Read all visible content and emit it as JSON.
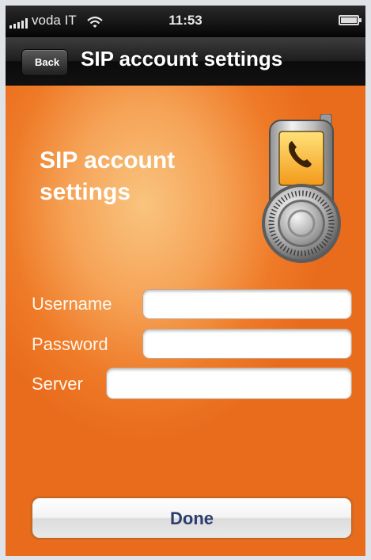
{
  "status_bar": {
    "carrier": "voda IT",
    "time": "11:53",
    "signal_icon": "signal-bars-icon",
    "wifi_icon": "wifi-icon",
    "battery_icon": "battery-icon",
    "battery_level": 1.0
  },
  "nav": {
    "back_label": "Back",
    "title": "SIP account settings"
  },
  "main": {
    "heading_line1": "SIP account",
    "heading_line2": "settings",
    "illustration_icon": "phone-lock-icon"
  },
  "form": {
    "username_label": "Username",
    "username_value": "",
    "password_label": "Password",
    "password_value": "",
    "server_label": "Server",
    "server_value": ""
  },
  "done_label": "Done",
  "colors": {
    "accent": "#ee7a27",
    "nav_bg": "#111111",
    "button_text": "#2a3d6e"
  }
}
